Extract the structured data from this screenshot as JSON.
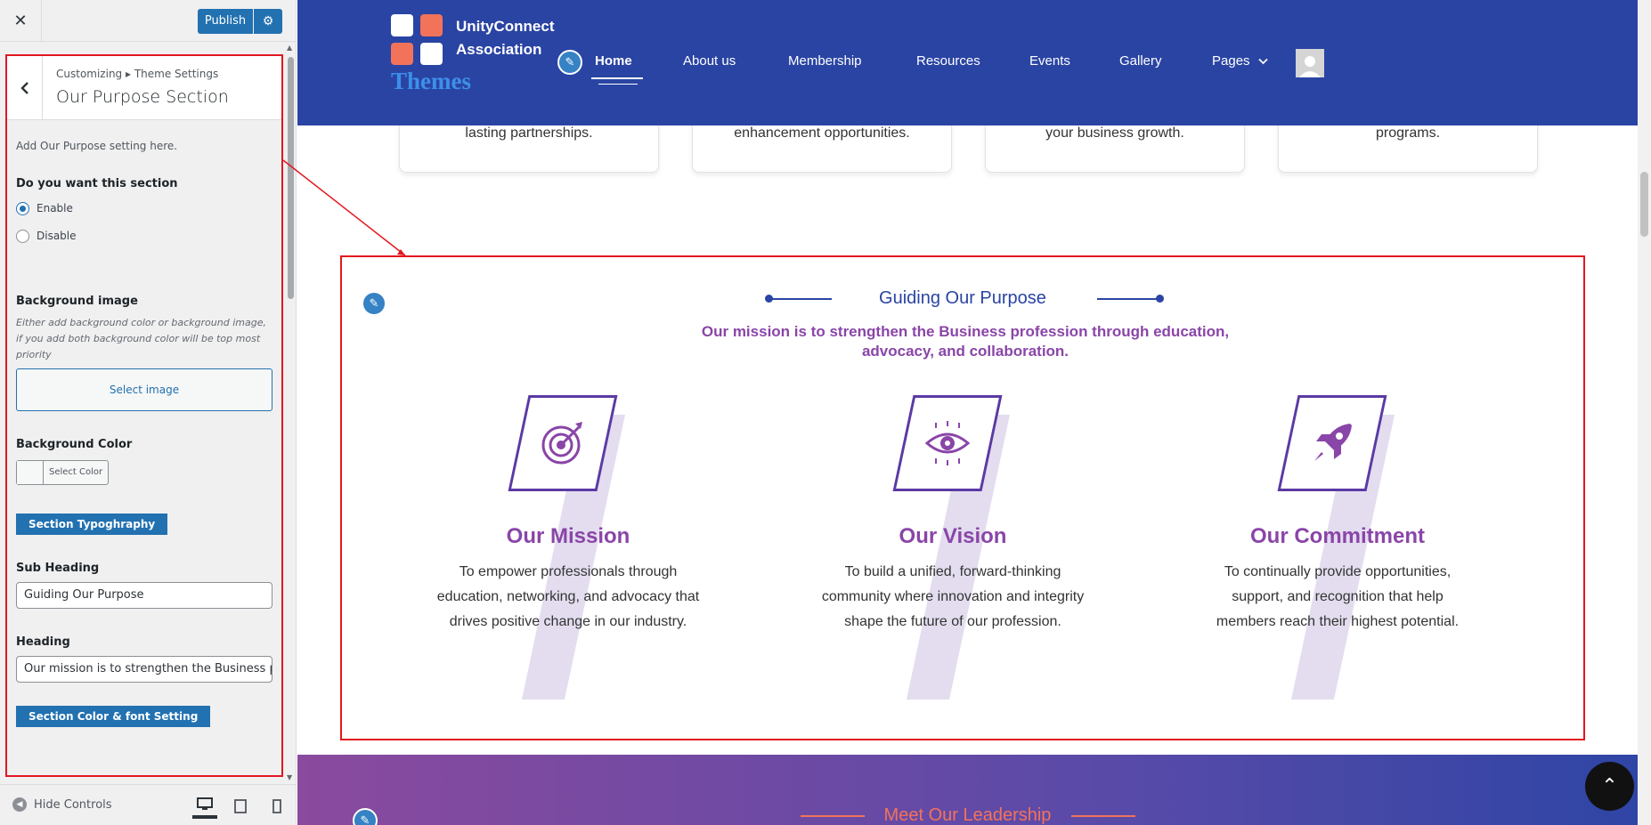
{
  "customizer": {
    "close_icon": "close-icon",
    "publish_label": "Publish",
    "publish_settings_icon": "gear-icon",
    "breadcrumb": "Customizing ▸ Theme Settings",
    "section_title": "Our Purpose Section",
    "description": "Add Our Purpose setting here.",
    "toggle_label": "Do you want this section",
    "enable_label": "Enable",
    "disable_label": "Disable",
    "enabled": true,
    "bg_image_label": "Background image",
    "bg_image_note": "Either add background color or background image, if you add both background color will be top most priority",
    "select_image_label": "Select image",
    "bg_color_label": "Background Color",
    "select_color_label": "Select Color",
    "typography_btn": "Section Typoghraphy",
    "sub_heading_label": "Sub Heading",
    "sub_heading_value": "Guiding Our Purpose",
    "heading_label": "Heading",
    "heading_value": "Our mission is to strengthen the Business profession through education, advocacy, and collaboration.",
    "color_font_btn": "Section Color & font Setting",
    "hide_controls": "Hide Controls"
  },
  "site": {
    "logo_line1": "UnityConnect",
    "logo_line2": "Association",
    "themes_text": "Themes",
    "nav": [
      "Home",
      "About us",
      "Membership",
      "Resources",
      "Events",
      "Gallery",
      "Pages"
    ],
    "cards": [
      {
        "line1": "lasting partnerships."
      },
      {
        "line1": "enhancement opportunities."
      },
      {
        "line1": "your business growth."
      },
      {
        "line1": "programs."
      }
    ],
    "purpose": {
      "sub_heading": "Guiding Our Purpose",
      "heading": "Our mission is to strengthen the Business profession through education, advocacy, and collaboration.",
      "columns": [
        {
          "title": "Our Mission",
          "text": "To empower professionals through education, networking, and advocacy that drives positive change in our industry.",
          "icon": "target-icon"
        },
        {
          "title": "Our Vision",
          "text": "To build a unified, forward-thinking community where innovation and integrity shape the future of our profession.",
          "icon": "eye-icon"
        },
        {
          "title": "Our Commitment",
          "text": "To continually provide opportunities, support, and recognition that help members reach their highest potential.",
          "icon": "rocket-icon"
        }
      ]
    },
    "leadership_title": "Meet Our Leadership"
  },
  "colors": {
    "header_bg": "#2a44a3",
    "accent_purple": "#8a45a8",
    "accent_coral": "#f2735a",
    "wp_blue": "#2271b1",
    "highlight_red": "#e2171f"
  }
}
